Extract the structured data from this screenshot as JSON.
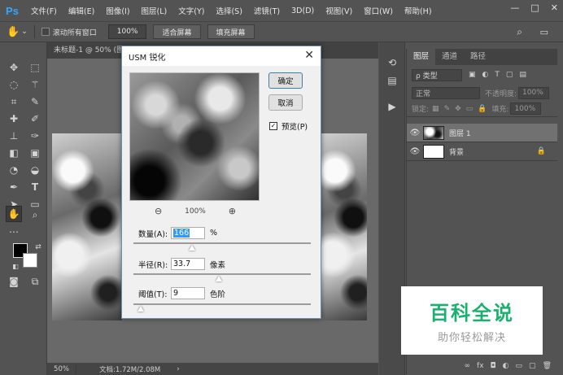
{
  "app": {
    "logo": "Ps"
  },
  "menu": [
    "文件(F)",
    "编辑(E)",
    "图像(I)",
    "图层(L)",
    "文字(Y)",
    "选择(S)",
    "滤镜(T)",
    "3D(D)",
    "视图(V)",
    "窗口(W)",
    "帮助(H)"
  ],
  "window_controls": {
    "minimize": "—",
    "maximize": "□",
    "close": "✕"
  },
  "options": {
    "scroll_all_label": "滚动所有窗口",
    "zoom_value": "100%",
    "fit_screen_label": "适合屏幕",
    "fill_screen_label": "填充屏幕"
  },
  "document": {
    "tab_title": "未标题-1 @ 50% (图层 1,",
    "status_zoom": "50%",
    "status_doc": "文档:1.72M/2.08M",
    "status_arrow": "›"
  },
  "layers_panel": {
    "tabs": [
      "图层",
      "通道",
      "路径"
    ],
    "kind_label": "ρ 类型",
    "blend_mode": "正常",
    "opacity_label": "不透明度:",
    "opacity_value": "100%",
    "lock_label": "锁定:",
    "fill_label": "填充:",
    "fill_value": "100%",
    "layers": [
      {
        "name": "图层 1",
        "selected": true
      },
      {
        "name": "背景",
        "selected": false
      }
    ],
    "footer_icons": [
      "∞",
      "fx",
      "◘",
      "◐",
      "▭",
      "▢",
      "🗑"
    ]
  },
  "dialog": {
    "title": "USM 锐化",
    "ok_label": "确定",
    "cancel_label": "取消",
    "preview_label": "预览(P)",
    "preview_checked": true,
    "zoom_percent": "100%",
    "amount_label": "数量(A):",
    "amount_value": "166",
    "amount_unit": "%",
    "amount_fraction": 0.33,
    "radius_label": "半径(R):",
    "radius_value": "33.7",
    "radius_unit": "像素",
    "radius_fraction": 0.48,
    "threshold_label": "阈值(T):",
    "threshold_value": "9",
    "threshold_unit": "色阶",
    "threshold_fraction": 0.04
  },
  "watermark": {
    "main": "百科全说",
    "sub": "助你轻松解决"
  },
  "colors": {
    "accent": "#31a8ff",
    "watermark_green": "#1ab06e",
    "selection": "#3399ff"
  }
}
